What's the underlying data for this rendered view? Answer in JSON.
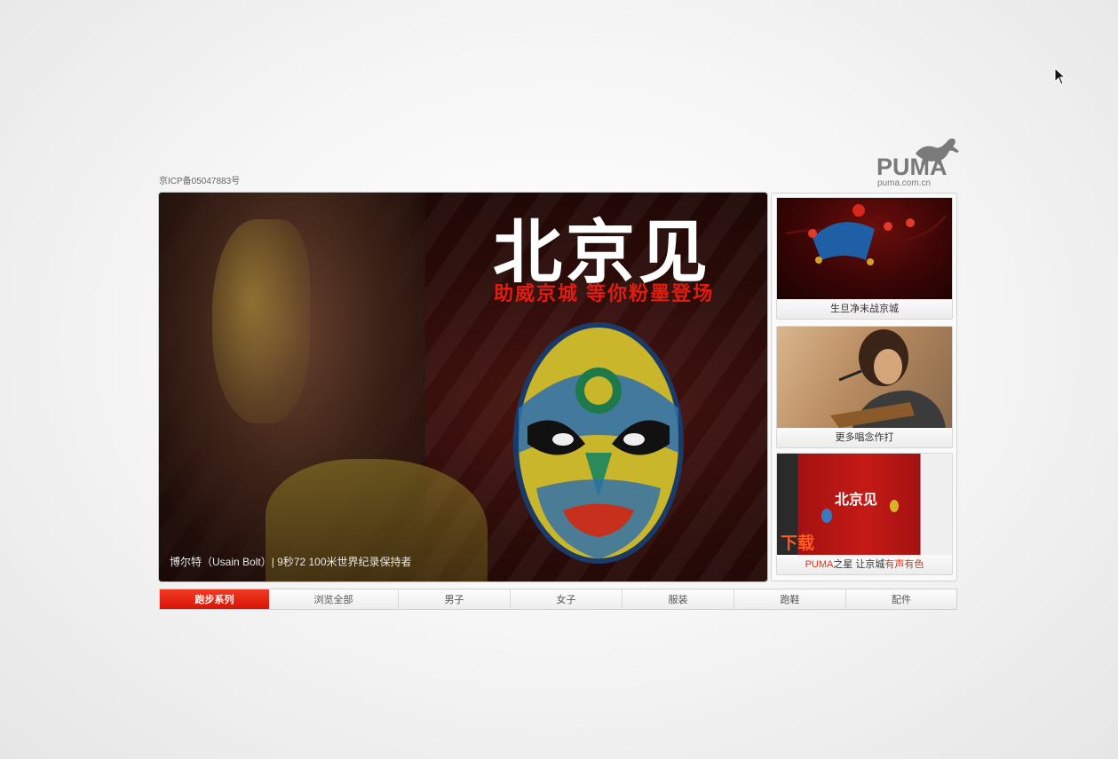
{
  "icp": "京ICP备05047883号",
  "logo": {
    "brand": "PUMA",
    "url": "puma.com.cn",
    "icon": "puma-cat-logo"
  },
  "hero": {
    "title": "北京见",
    "subtitle": "助威京城 等你粉墨登场",
    "caption": "博尔特（Usain Bolt）| 9秒72 100米世界纪录保持者"
  },
  "side": {
    "cards": [
      {
        "label": "生旦净末战京城"
      },
      {
        "label": "更多唱念作打"
      },
      {
        "label_prefix": "PUMA",
        "label_mid": "之星 让京城",
        "label_suffix": "有声有色",
        "overlay_title": "北京见",
        "overlay_download": "下载"
      }
    ]
  },
  "nav": {
    "items": [
      "跑步系列",
      "浏览全部",
      "男子",
      "女子",
      "服装",
      "跑鞋",
      "配件"
    ],
    "active_index": 0
  },
  "colors": {
    "accent_red": "#e2341c",
    "nav_active": "#e3200f"
  }
}
